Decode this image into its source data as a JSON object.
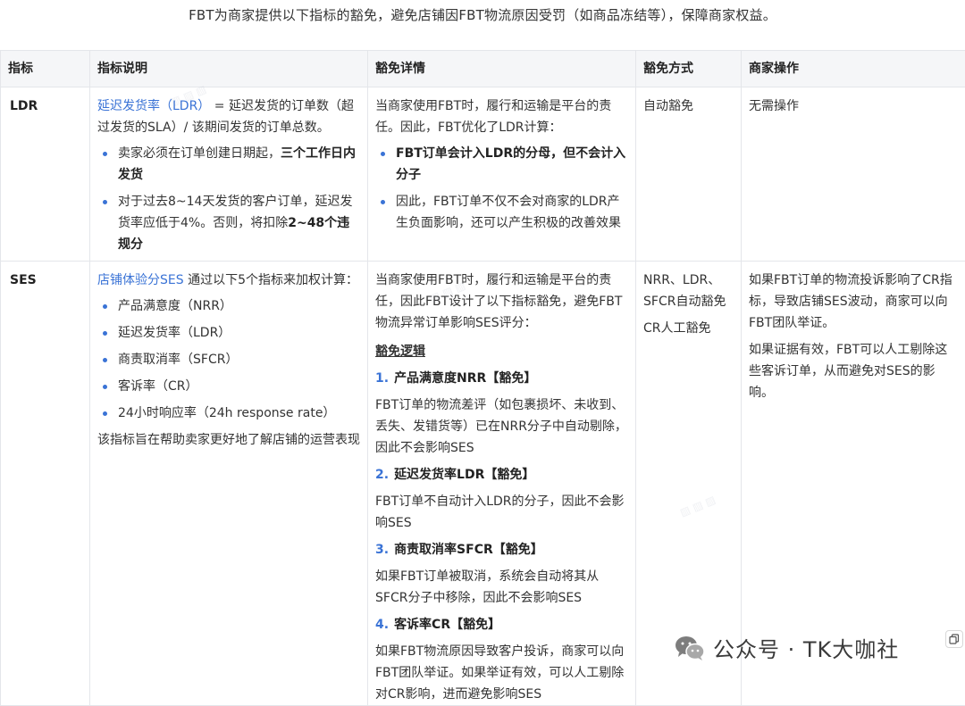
{
  "intro": "FBT为商家提供以下指标的豁免，避免店铺因FBT物流原因受罚（如商品冻结等），保障商家权益。",
  "headers": [
    "指标",
    "指标说明",
    "豁免详情",
    "豁免方式",
    "商家操作"
  ],
  "ldr": {
    "name": "LDR",
    "desc_link": "延迟发货率（LDR）",
    "desc_text": " = 延迟发货的订单数（超过发货的SLA）/ 该期间发货的订单总数。",
    "bullet1_text": "卖家必须在订单创建日期起，",
    "bullet1_bold": "三个工作日内发货",
    "bullet2_text": "对于过去8~14天发货的客户订单，延迟发货率应低于4%。否则，将扣除",
    "bullet2_bold": "2~48个违规分",
    "detail_p": "当商家使用FBT时，履行和运输是平台的责任。因此，FBT优化了LDR计算：",
    "detail_b1": "FBT订单会计入LDR的分母，但不会计入分子",
    "detail_b2": "因此，FBT订单不仅不会对商家的LDR产生负面影响，还可以产生积极的改善效果",
    "method": "自动豁免",
    "action": "无需操作"
  },
  "ses": {
    "name": "SES",
    "desc_link": "店铺体验分SES",
    "desc_text": " 通过以下5个指标来加权计算：",
    "items": [
      "产品满意度（NRR）",
      "延迟发货率（LDR）",
      "商责取消率（SFCR）",
      "客诉率（CR）",
      "24小时响应率（24h response rate）"
    ],
    "desc_footer": "该指标旨在帮助卖家更好地了解店铺的运营表现",
    "detail_p": "当商家使用FBT时，履行和运输是平台的责任，因此FBT设计了以下指标豁免，避免FBT物流异常订单影响SES评分：",
    "logic_title": "豁免逻辑",
    "subs": [
      {
        "num": "1.",
        "title": "产品满意度NRR【豁免】",
        "text": "FBT订单的物流差评（如包裹损坏、未收到、丢失、发错货等）已在NRR分子中自动剔除，因此不会影响SES"
      },
      {
        "num": "2.",
        "title": "延迟发货率LDR【豁免】",
        "text": "FBT订单不自动计入LDR的分子，因此不会影响SES"
      },
      {
        "num": "3.",
        "title": "商责取消率SFCR【豁免】",
        "text": "如果FBT订单被取消，系统会自动将其从SFCR分子中移除，因此不会影响SES"
      },
      {
        "num": "4.",
        "title": "客诉率CR【豁免】",
        "text": "如果FBT物流原因导致客户投诉，商家可以向FBT团队举证。如果举证有效，可以人工剔除对CR影响，进而避免影响SES"
      }
    ],
    "method1": "NRR、LDR、SFCR自动豁免",
    "method2": "CR人工豁免",
    "action1": "如果FBT订单的物流投诉影响了CR指标，导致店铺SES波动，商家可以向FBT团队举证。",
    "action2": "如果证据有效，FBT可以人工剔除这些客诉订单，从而避免对SES的影响。"
  },
  "brand": {
    "text": "公众号 · TK大咖社",
    "icon": "wechat-icon"
  },
  "copy_icon": "copy-icon",
  "colors": {
    "link": "#3a73d6",
    "header_bg": "#f5f6f8",
    "border": "#e4e6ea"
  }
}
